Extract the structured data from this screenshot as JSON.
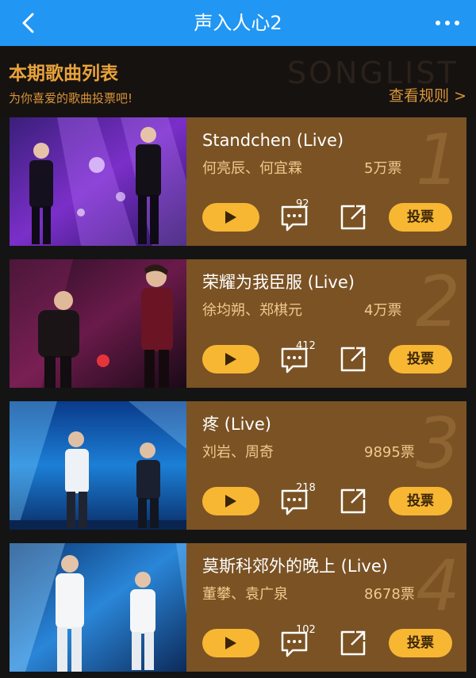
{
  "topbar": {
    "title": "声入人心2",
    "back_icon": "chevron-left-icon",
    "more_icon": "more-dots-icon",
    "color": "#2196f3"
  },
  "header": {
    "title": "本期歌曲列表",
    "subtitle": "为你喜爱的歌曲投票吧!",
    "watermark": "SONGLIST",
    "rules_link": "查看规则 >"
  },
  "songs": [
    {
      "rank": "1",
      "title": "Standchen (Live)",
      "singers": "何亮辰、何宜霖",
      "votes": "5万票",
      "comments": "92",
      "vote_label": "投票"
    },
    {
      "rank": "2",
      "title": "荣耀为我臣服 (Live)",
      "singers": "徐均朔、郑棋元",
      "votes": "4万票",
      "comments": "412",
      "vote_label": "投票"
    },
    {
      "rank": "3",
      "title": "疼 (Live)",
      "singers": "刘岩、周奇",
      "votes": "9895票",
      "comments": "218",
      "vote_label": "投票"
    },
    {
      "rank": "4",
      "title": "莫斯科郊外的晚上 (Live)",
      "singers": "董攀、袁广泉",
      "votes": "8678票",
      "comments": "102",
      "vote_label": "投票"
    }
  ],
  "colors": {
    "accent": "#f7b733",
    "card_bg": "#7a5224",
    "header_text": "#e8a23a"
  }
}
